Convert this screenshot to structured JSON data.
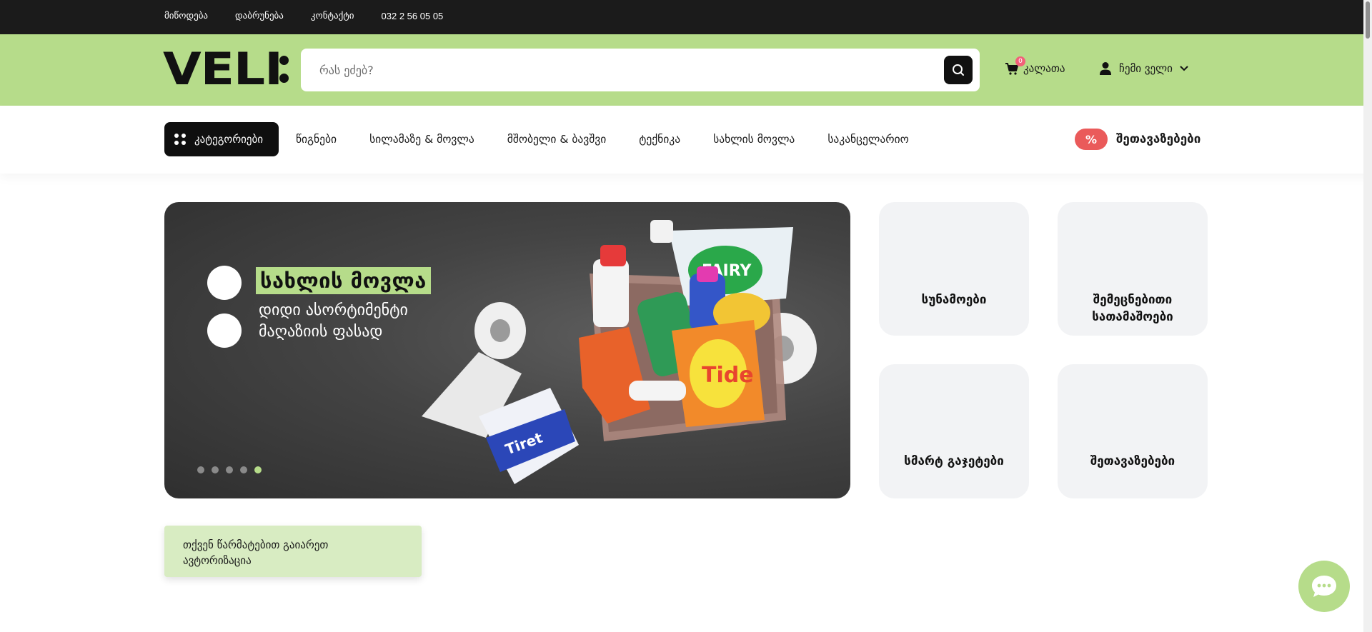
{
  "topbar": {
    "links": [
      "მიწოდება",
      "დაბრუნება",
      "კონტაქტი"
    ],
    "phone": "032 2 56 05 05"
  },
  "header": {
    "logo": "VELI",
    "search_placeholder": "რას ეძებ?",
    "cart_label": "კალათა",
    "cart_count": "0",
    "account_label": "ჩემი ველი"
  },
  "nav": {
    "categories_label": "კატეგორიები",
    "items": [
      "წიგნები",
      "სილამაზე & მოვლა",
      "მშობელი & ბავშვი",
      "ტექნიკა",
      "სახლის მოვლა",
      "საკანცელარიო"
    ],
    "deals_badge": "%",
    "deals_label": "შეთავაზებები"
  },
  "hero": {
    "title": "სახლის მოვლა",
    "subtitle_line1": "დიდი ასორტიმენტი",
    "subtitle_line2": "მაღაზიის ფასად",
    "slide_count": 5,
    "active_slide": 5
  },
  "tiles": [
    "სუნამოები",
    "შემეცნებითი სათამაშოები",
    "სმარტ გაჯეტები",
    "შეთავაზებები"
  ],
  "auth_toast": {
    "line1": "თქვენ წარმატებით გაიარეთ",
    "line2": "ავტორიზაცია"
  },
  "colors": {
    "brand_green": "#b6dc8a",
    "topbar": "#1b1b1b",
    "deals_red": "#ea5a5a",
    "tile_bg": "#f2f3f5"
  },
  "icons": [
    "search-icon",
    "cart-icon",
    "user-icon",
    "chevron-down-icon",
    "grid-icon",
    "chat-icon"
  ]
}
